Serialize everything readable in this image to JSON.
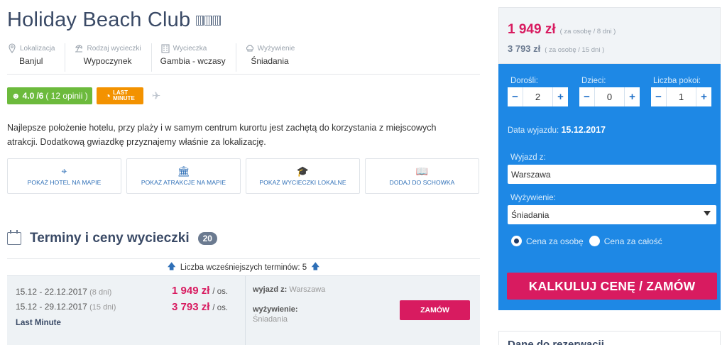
{
  "hotel": {
    "name": "Holiday Beach Club",
    "star_count": 3
  },
  "info": [
    {
      "label": "Lokalizacja",
      "value": "Banjul",
      "icon": "map-pin-icon"
    },
    {
      "label": "Rodzaj wycieczki",
      "value": "Wypoczynek",
      "icon": "beach-icon"
    },
    {
      "label": "Wycieczka",
      "value": "Gambia - wczasy",
      "icon": "building-icon"
    },
    {
      "label": "Wyżywienie",
      "value": "Śniadania",
      "icon": "chef-hat-icon"
    }
  ],
  "rating": {
    "score": "4.0",
    "scale": "/6",
    "reviews": "( 12 opinii )",
    "color": "#6cba3c"
  },
  "last_minute": {
    "line1": "LAST",
    "line2": "MINUTE",
    "color": "#f39200"
  },
  "description": "Najlepsze położenie hotelu, przy plaży i w samym centrum kurortu jest zachętą do korzystania z miejscowych atrakcji. Dodatkową gwiazdkę przyznajemy właśnie za lokalizację.",
  "actions": [
    {
      "label": "POKAŻ HOTEL NA MAPIE",
      "icon": "map-pin-icon"
    },
    {
      "label": "POKAŻ ATRAKCJE NA MAPIE",
      "icon": "museum-icon"
    },
    {
      "label": "POKAŻ WYCIECZKI LOKALNE",
      "icon": "graduation-cap-icon"
    },
    {
      "label": "DODAJ DO SCHOWKA",
      "icon": "book-icon"
    }
  ],
  "terms": {
    "title": "Terminy i ceny wycieczki",
    "count": "20",
    "earlier": "Liczba wcześniejszych terminów: 5",
    "row": {
      "dates": [
        {
          "range": "15.12 - 22.12.2017",
          "days": "(8 dni)",
          "price": "1 949 zł",
          "unit": "/ os."
        },
        {
          "range": "15.12 - 29.12.2017",
          "days": "(15 dni)",
          "price": "3 793 zł",
          "unit": "/ os."
        }
      ],
      "badge": "Last Minute",
      "departure_label": "wyjazd z:",
      "departure_value": "Warszawa",
      "board_label": "wyżywienie:",
      "board_value": "Śniadania",
      "order_label": "ZAMÓW"
    }
  },
  "price_box": {
    "price1": "1 949 zł",
    "note1": "( za osobę / 8 dni )",
    "price2": "3 793 zł",
    "note2": "( za osobę / 15 dni )"
  },
  "calc": {
    "adults_label": "Dorośli:",
    "adults": "2",
    "children_label": "Dzieci:",
    "children": "0",
    "rooms_label": "Liczba pokoi:",
    "rooms": "1",
    "minus": "−",
    "plus": "+",
    "date_label": "Data wyjazdu:",
    "date": "15.12.2017",
    "departure_label": "Wyjazd z:",
    "departure": "Warszawa",
    "board_label": "Wyżywienie:",
    "board": "Śniadania",
    "radio_person": "Cena za osobę",
    "radio_total": "Cena za całość",
    "selected_radio": "person",
    "button": "KALKULUJ CENĘ / ZAMÓW",
    "bg_color": "#1e88e5",
    "accent": "#d81b60"
  },
  "bottom": {
    "text": "Dane do rezerwacji"
  }
}
